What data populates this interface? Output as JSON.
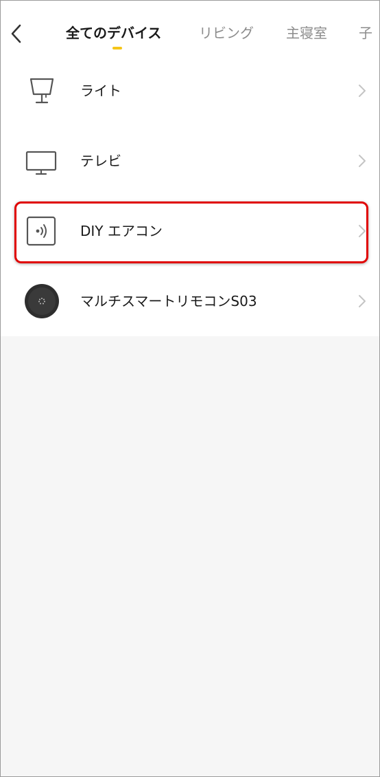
{
  "header": {
    "tabs": [
      {
        "label": "全てのデバイス",
        "active": true
      },
      {
        "label": "リビング",
        "active": false
      },
      {
        "label": "主寝室",
        "active": false
      },
      {
        "label": "子",
        "active": false
      }
    ],
    "indicator_color": "#f5c518"
  },
  "devices": [
    {
      "label": "ライト",
      "icon": "lamp-icon"
    },
    {
      "label": "テレビ",
      "icon": "tv-icon"
    },
    {
      "label": "DIY エアコン",
      "icon": "ir-remote-icon"
    },
    {
      "label": "マルチスマートリモコンS03",
      "icon": "smart-remote-hub-icon"
    }
  ],
  "highlight_color": "#e00000"
}
